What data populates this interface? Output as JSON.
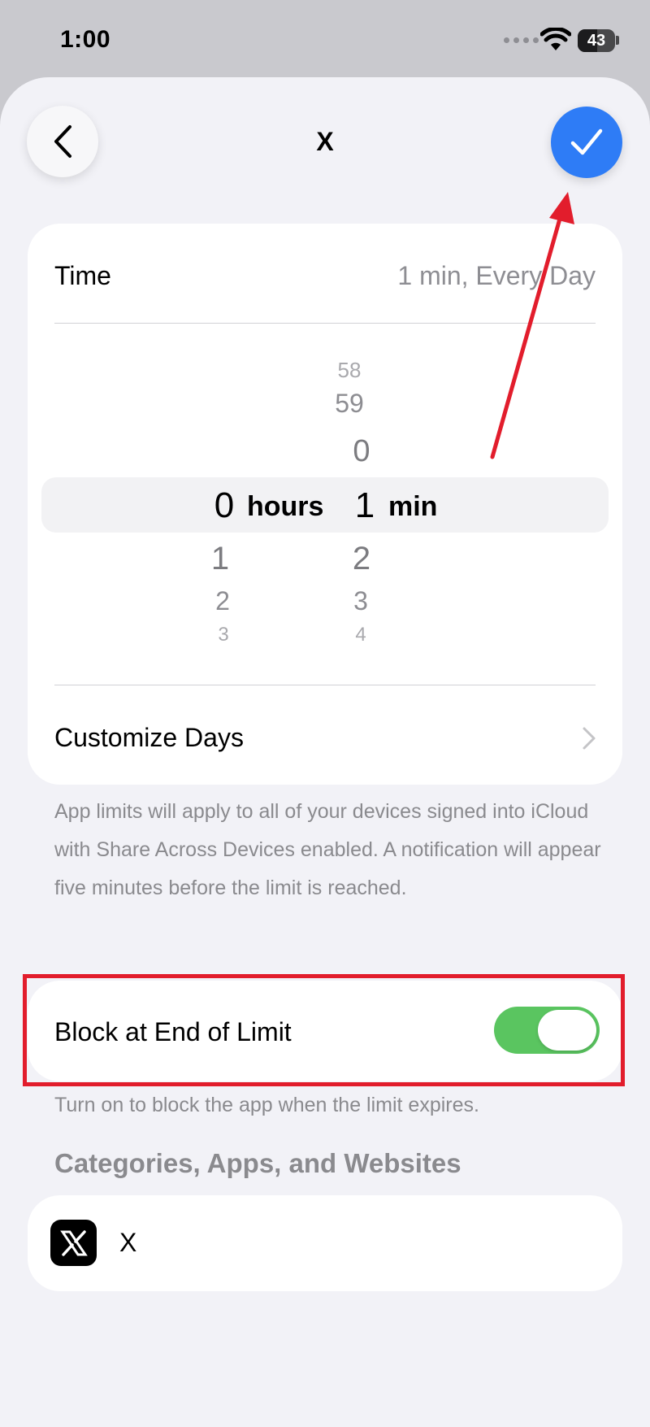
{
  "status_bar": {
    "time": "1:00",
    "battery": "43"
  },
  "nav": {
    "title": "X"
  },
  "time_row": {
    "label": "Time",
    "value": "1 min, Every Day"
  },
  "picker": {
    "hours": {
      "above": [
        "",
        "",
        ""
      ],
      "selected": "0",
      "unit": "hours",
      "below": [
        "1",
        "2",
        "3"
      ]
    },
    "minutes": {
      "above": [
        "58",
        "59",
        "0"
      ],
      "selected": "1",
      "unit": "min",
      "below": [
        "2",
        "3",
        "4"
      ]
    }
  },
  "customize_days": {
    "label": "Customize Days"
  },
  "app_limits_note": "App limits will apply to all of your devices signed into iCloud with Share Across Devices enabled. A notification will appear five minutes before the limit is reached.",
  "block_row": {
    "label": "Block at End of Limit",
    "enabled": true
  },
  "block_note": "Turn on to block the app when the limit expires.",
  "categories": {
    "header": "Categories, Apps, and Websites",
    "apps": [
      {
        "name": "X",
        "icon": "x-logo-icon"
      }
    ]
  },
  "colors": {
    "accent": "#2e7cf6",
    "toggle_on": "#5ac560",
    "annotation_red": "#e21d2c",
    "background": "#f2f2f7"
  }
}
